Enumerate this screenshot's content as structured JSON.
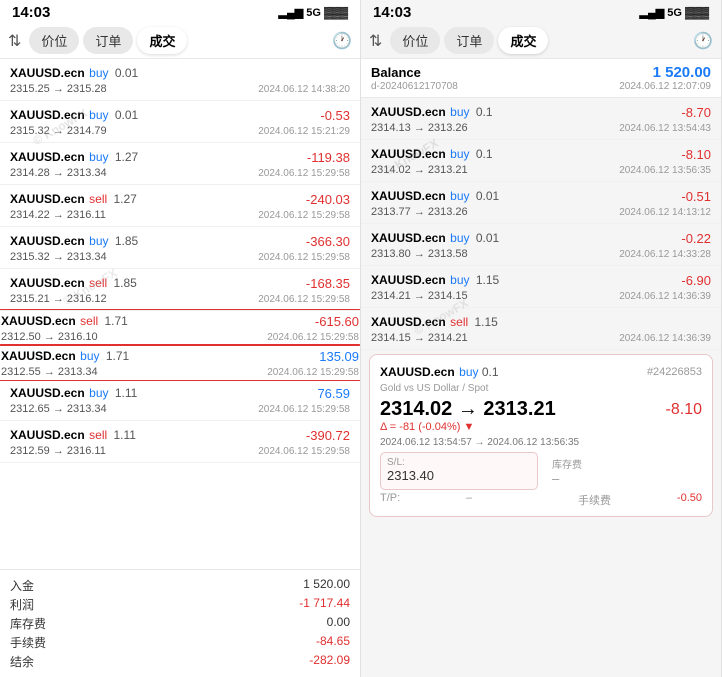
{
  "left": {
    "statusBar": {
      "time": "14:03",
      "signal": "▂▄▆ 5G",
      "battery": "🔋"
    },
    "tabs": [
      "价位",
      "订单",
      "成交"
    ],
    "activeTab": "成交",
    "trades": [
      {
        "id": "t1",
        "symbol": "XAUUSD.ecn",
        "action": "buy",
        "size": "0.01",
        "priceRange": "2315.25 → 2315.28",
        "date": "2024.06.12 14:38:20",
        "pnl": "",
        "pnlType": "none",
        "highlight": false
      },
      {
        "id": "t2",
        "symbol": "XAUUSD.ecn",
        "action": "buy",
        "size": "0.01",
        "priceRange": "2315.32 → 2314.79",
        "date": "2024.06.12 15:21:29",
        "pnl": "-0.53",
        "pnlType": "neg",
        "highlight": false
      },
      {
        "id": "t3",
        "symbol": "XAUUSD.ecn",
        "action": "buy",
        "size": "1.27",
        "priceRange": "2314.28 → 2313.34",
        "date": "2024.06.12 15:29:58",
        "pnl": "-119.38",
        "pnlType": "neg",
        "highlight": false
      },
      {
        "id": "t4",
        "symbol": "XAUUSD.ecn",
        "action": "sell",
        "size": "1.27",
        "priceRange": "2314.22 → 2316.11",
        "date": "2024.06.12 15:29:58",
        "pnl": "-240.03",
        "pnlType": "neg",
        "highlight": false
      },
      {
        "id": "t5",
        "symbol": "XAUUSD.ecn",
        "action": "buy",
        "size": "1.85",
        "priceRange": "2315.32 → 2313.34",
        "date": "2024.06.12 15:29:58",
        "pnl": "-366.30",
        "pnlType": "neg",
        "highlight": false
      },
      {
        "id": "t6",
        "symbol": "XAUUSD.ecn",
        "action": "sell",
        "size": "1.85",
        "priceRange": "2315.21 → 2316.12",
        "date": "2024.06.12 15:29:58",
        "pnl": "-168.35",
        "pnlType": "neg",
        "highlight": false
      },
      {
        "id": "t7",
        "symbol": "XAUUSD.ecn",
        "action": "sell",
        "size": "1.71",
        "priceRange": "2312.50 → 2316.10",
        "date": "2024.06.12 15:29:58",
        "pnl": "-615.60",
        "pnlType": "neg",
        "highlight": true
      },
      {
        "id": "t8",
        "symbol": "XAUUSD.ecn",
        "action": "buy",
        "size": "1.71",
        "priceRange": "2312.55 → 2313.34",
        "date": "2024.06.12 15:29:58",
        "pnl": "135.09",
        "pnlType": "pos",
        "highlight": true
      },
      {
        "id": "t9",
        "symbol": "XAUUSD.ecn",
        "action": "buy",
        "size": "1.11",
        "priceRange": "2312.65 → 2313.34",
        "date": "2024.06.12 15:29:58",
        "pnl": "76.59",
        "pnlType": "pos",
        "highlight": false
      },
      {
        "id": "t10",
        "symbol": "XAUUSD.ecn",
        "action": "sell",
        "size": "1.11",
        "priceRange": "2312.59 → 2316.11",
        "date": "2024.06.12 15:29:58",
        "pnl": "-390.72",
        "pnlType": "neg",
        "highlight": false
      }
    ],
    "summary": [
      {
        "label": "入金",
        "val": "1 520.00",
        "type": "normal"
      },
      {
        "label": "利润",
        "val": "-1 717.44",
        "type": "neg"
      },
      {
        "label": "库存费",
        "val": "0.00",
        "type": "normal"
      },
      {
        "label": "手续费",
        "val": "-84.65",
        "type": "neg"
      },
      {
        "label": "结余",
        "val": "-282.09",
        "type": "neg"
      }
    ]
  },
  "right": {
    "statusBar": {
      "time": "14:03",
      "signal": "▂▄▆ 5G",
      "battery": "🔋"
    },
    "tabs": [
      "价位",
      "订单",
      "成交"
    ],
    "activeTab": "成交",
    "balance": {
      "label": "Balance",
      "val": "1 520.00",
      "id": "d-20240612170708",
      "date": "2024.06.12 12:07:09"
    },
    "trades": [
      {
        "id": "r1",
        "symbol": "XAUUSD.ecn",
        "action": "buy",
        "size": "0.1",
        "priceRange": "2314.13 → 2313.26",
        "date": "2024.06.12 13:54:43",
        "pnl": "-8.70",
        "pnlType": "neg"
      },
      {
        "id": "r2",
        "symbol": "XAUUSD.ecn",
        "action": "buy",
        "size": "0.1",
        "priceRange": "2314.02 → 2313.21",
        "date": "2024.06.12 13:56:35",
        "pnl": "-8.10",
        "pnlType": "neg"
      },
      {
        "id": "r3",
        "symbol": "XAUUSD.ecn",
        "action": "buy",
        "size": "0.01",
        "priceRange": "2313.77 → 2313.26",
        "date": "2024.06.12 14:13:12",
        "pnl": "-0.51",
        "pnlType": "neg"
      },
      {
        "id": "r4",
        "symbol": "XAUUSD.ecn",
        "action": "buy",
        "size": "0.01",
        "priceRange": "2313.80 → 2313.58",
        "date": "2024.06.12 14:33:28",
        "pnl": "-0.22",
        "pnlType": "neg"
      },
      {
        "id": "r5",
        "symbol": "XAUUSD.ecn",
        "action": "buy",
        "size": "1.15",
        "priceRange": "2314.21 → 2314.15",
        "date": "2024.06.12 14:36:39",
        "pnl": "-6.90",
        "pnlType": "neg"
      },
      {
        "id": "r6",
        "symbol": "XAUUSD.ecn",
        "action": "sell",
        "size": "1.15",
        "priceRange": "2314.15 → 2314.21",
        "date": "2024.06.12 14:36:39",
        "pnl": "",
        "pnlType": "none"
      }
    ],
    "detail": {
      "symbol": "XAUUSD.ecn",
      "action": "buy",
      "size": "0.1",
      "orderId": "#24226853",
      "description": "Gold vs US Dollar / Spot",
      "priceFrom": "2314.02",
      "priceTo": "2313.21",
      "pnl": "-8.10",
      "delta": "Δ = -81 (-0.04%)",
      "dateRange": "2024.06.12 13:54:57 → 2024.06.12 13:56:35",
      "sl": "2313.40",
      "tp": "–",
      "storage": "–",
      "fee": "-0.50"
    }
  }
}
